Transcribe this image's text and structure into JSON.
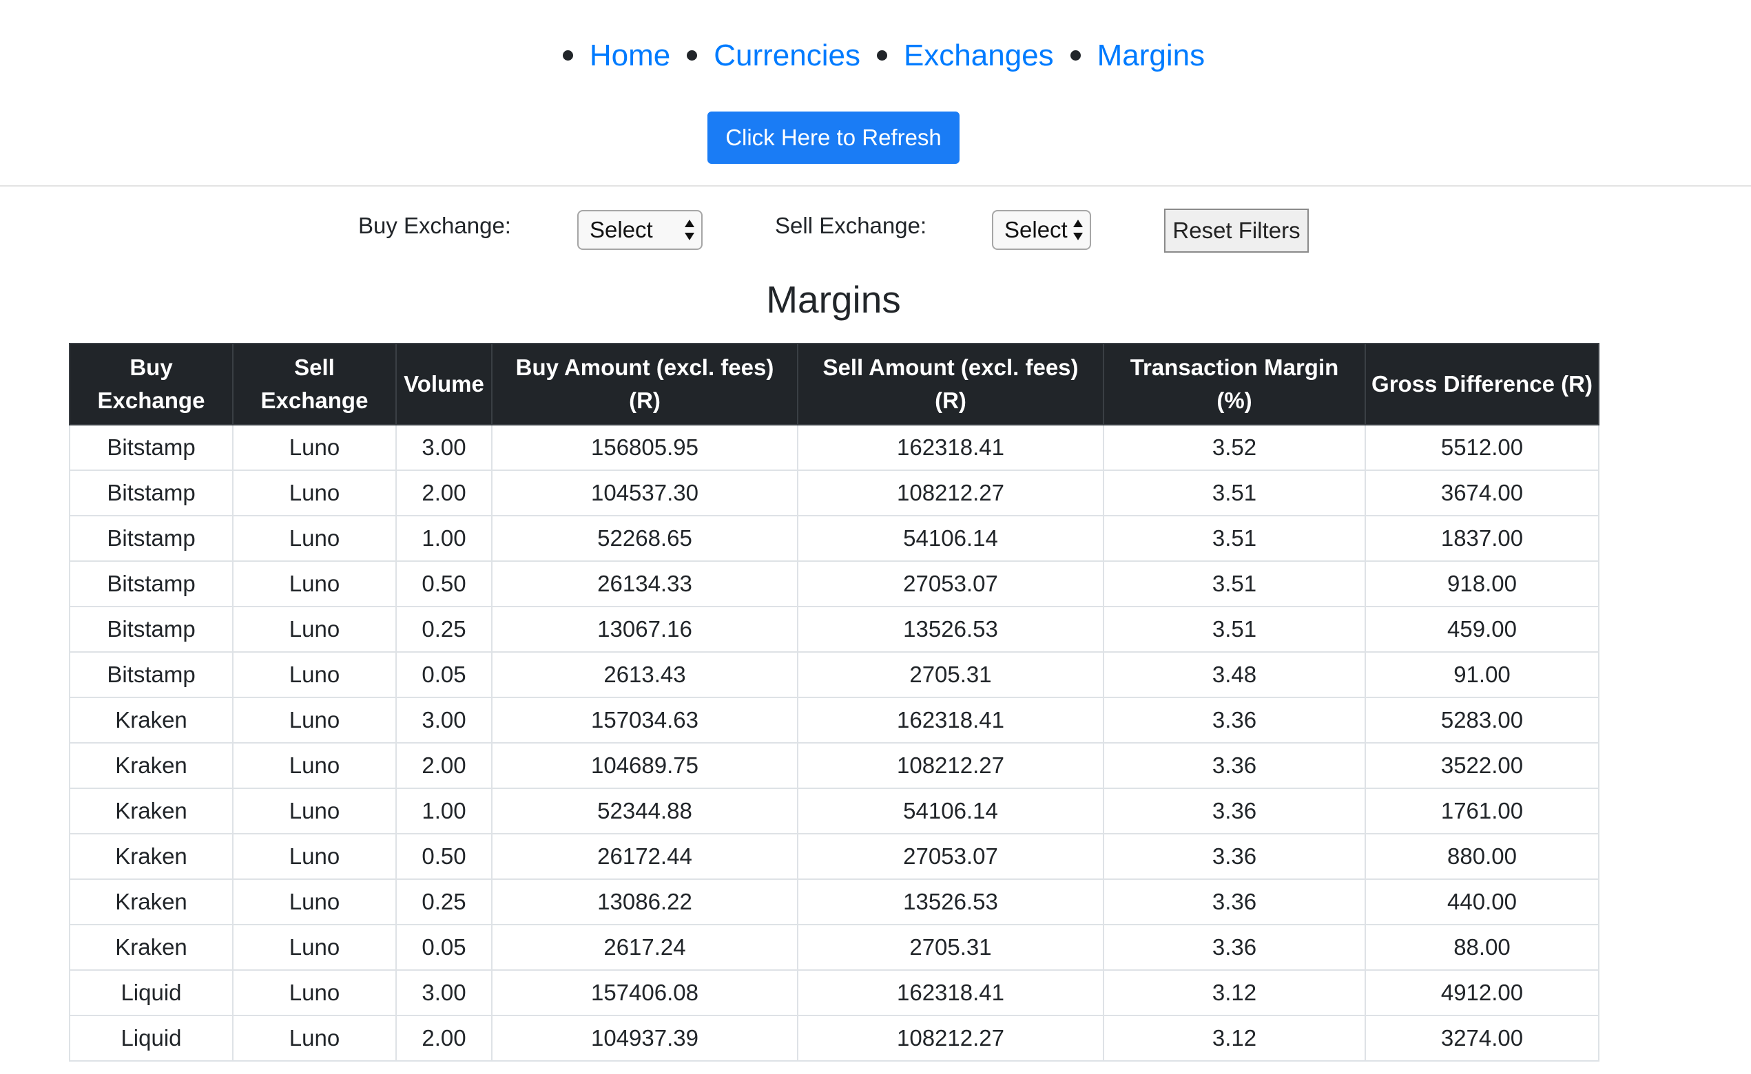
{
  "nav": {
    "items": [
      {
        "label": "Home"
      },
      {
        "label": "Currencies"
      },
      {
        "label": "Exchanges"
      },
      {
        "label": "Margins"
      }
    ]
  },
  "refresh_button": {
    "label": "Click Here to Refresh"
  },
  "filters": {
    "buy_label": "Buy Exchange:",
    "buy_value": "Select",
    "sell_label": "Sell Exchange:",
    "sell_value": "Select",
    "reset_label": "Reset Filters"
  },
  "page_title": "Margins",
  "colors": {
    "link": "#007bff",
    "button": "#1a7cf5",
    "table_header": "#212529"
  },
  "table": {
    "headers": [
      "Buy Exchange",
      "Sell Exchange",
      "Volume",
      "Buy Amount (excl. fees) (R)",
      "Sell Amount (excl. fees) (R)",
      "Transaction Margin (%)",
      "Gross Difference (R)"
    ],
    "rows": [
      [
        "Bitstamp",
        "Luno",
        "3.00",
        "156805.95",
        "162318.41",
        "3.52",
        "5512.00"
      ],
      [
        "Bitstamp",
        "Luno",
        "2.00",
        "104537.30",
        "108212.27",
        "3.51",
        "3674.00"
      ],
      [
        "Bitstamp",
        "Luno",
        "1.00",
        "52268.65",
        "54106.14",
        "3.51",
        "1837.00"
      ],
      [
        "Bitstamp",
        "Luno",
        "0.50",
        "26134.33",
        "27053.07",
        "3.51",
        "918.00"
      ],
      [
        "Bitstamp",
        "Luno",
        "0.25",
        "13067.16",
        "13526.53",
        "3.51",
        "459.00"
      ],
      [
        "Bitstamp",
        "Luno",
        "0.05",
        "2613.43",
        "2705.31",
        "3.48",
        "91.00"
      ],
      [
        "Kraken",
        "Luno",
        "3.00",
        "157034.63",
        "162318.41",
        "3.36",
        "5283.00"
      ],
      [
        "Kraken",
        "Luno",
        "2.00",
        "104689.75",
        "108212.27",
        "3.36",
        "3522.00"
      ],
      [
        "Kraken",
        "Luno",
        "1.00",
        "52344.88",
        "54106.14",
        "3.36",
        "1761.00"
      ],
      [
        "Kraken",
        "Luno",
        "0.50",
        "26172.44",
        "27053.07",
        "3.36",
        "880.00"
      ],
      [
        "Kraken",
        "Luno",
        "0.25",
        "13086.22",
        "13526.53",
        "3.36",
        "440.00"
      ],
      [
        "Kraken",
        "Luno",
        "0.05",
        "2617.24",
        "2705.31",
        "3.36",
        "88.00"
      ],
      [
        "Liquid",
        "Luno",
        "3.00",
        "157406.08",
        "162318.41",
        "3.12",
        "4912.00"
      ],
      [
        "Liquid",
        "Luno",
        "2.00",
        "104937.39",
        "108212.27",
        "3.12",
        "3274.00"
      ]
    ]
  }
}
